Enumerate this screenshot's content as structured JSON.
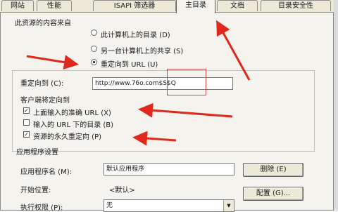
{
  "tabs": [
    "网站",
    "性能",
    "ISAPI 筛选器",
    "主目录",
    "文档",
    "目录安全性"
  ],
  "source_heading": "此资源的内容来自",
  "options": {
    "local_dir": "此计算机上的目录 (D)",
    "share": "另一台计算机上的共享 (S)",
    "redirect": "重定向到 URL (U)"
  },
  "redirect": {
    "label": "重定向到 (C):",
    "url": "http://www.76o.com$S$Q",
    "client_heading": "客户端将定向到",
    "exact_url": "上面输入的准确 URL (X)",
    "dir_below": "输入的 URL 下的目录 (B)",
    "permanent": "资源的永久重定向 (P)"
  },
  "app_settings": {
    "heading": "应用程序设置",
    "app_name_label": "应用程序名 (M):",
    "app_name_value": "默认应用程序",
    "remove_button": "删除 (E)",
    "start_label": "开始位置:",
    "start_value": "<默认>",
    "config_button": "配置 (G)...",
    "exec_label": "执行权限 (P):",
    "exec_value": "无"
  },
  "colors": {
    "arrow": "#e0281c",
    "highlight_box": "#c84a4a"
  }
}
